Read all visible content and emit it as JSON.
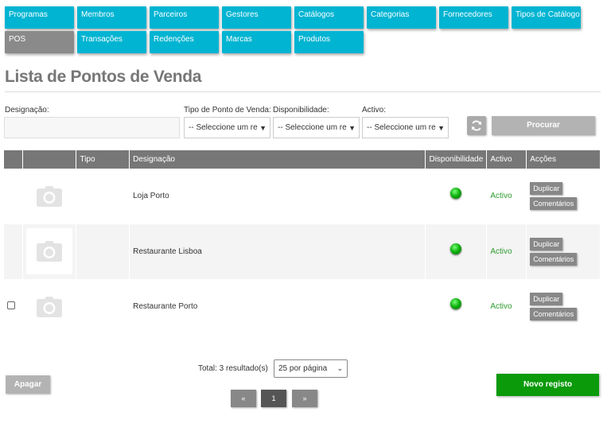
{
  "nav": {
    "row1": [
      "Programas",
      "Membros",
      "Parceiros",
      "Gestores",
      "Catálogos",
      "Categorias",
      "Fornecedores",
      "Tipos de Catálogo"
    ],
    "row2": [
      "POS",
      "Transações",
      "Redenções",
      "Marcas",
      "Produtos"
    ],
    "active": "POS"
  },
  "page": {
    "title": "Lista de Pontos de Venda"
  },
  "filters": {
    "designacao_label": "Designação:",
    "designacao_value": "",
    "tipo_label": "Tipo de Ponto de Venda:",
    "tipo_value": "-- Seleccione um re",
    "disp_label": "Disponibilidade:",
    "disp_value": "-- Seleccione um re",
    "activo_label": "Activo:",
    "activo_value": "-- Seleccione um re",
    "search_label": "Procurar"
  },
  "table": {
    "headers": [
      "",
      "",
      "Tipo",
      "Designação",
      "Disponibilidade",
      "Activo",
      "Acções"
    ],
    "rows": [
      {
        "tipo": "",
        "designacao": "Loja Porto",
        "activo": "Activo"
      },
      {
        "tipo": "",
        "designacao": "Restaurante Lisboa",
        "activo": "Activo"
      },
      {
        "tipo": "",
        "designacao": "Restaurante Porto",
        "activo": "Activo"
      }
    ],
    "action_duplicate": "Duplicar",
    "action_comments": "Comentários"
  },
  "footer": {
    "delete_label": "Apagar",
    "total_text": "Total: 3 resultado(s)",
    "per_page": "25 por página",
    "prev": "«",
    "page": "1",
    "next": "»",
    "new_label": "Novo registo"
  },
  "colors": {
    "nav": "#00b4d2",
    "nav_active": "#8a8a8a",
    "new": "#0a9a0a",
    "status": "#2e9b2e"
  }
}
